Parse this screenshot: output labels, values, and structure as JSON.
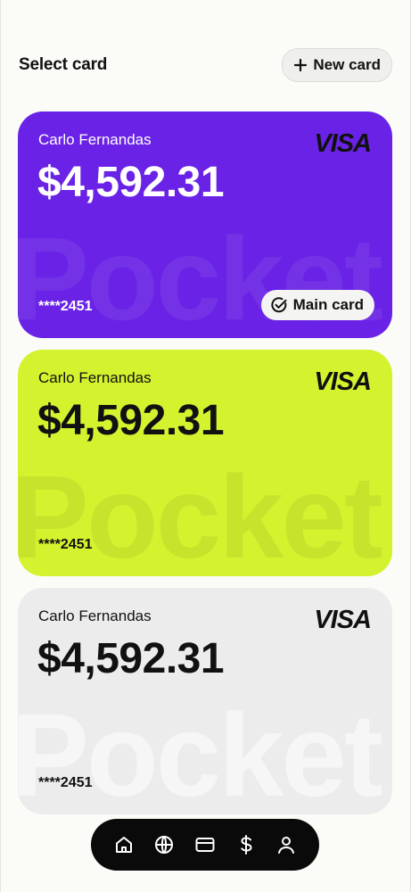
{
  "header": {
    "title": "Select card",
    "new_card_label": "New card"
  },
  "cards": [
    {
      "holder": "Carlo Fernandas",
      "balance": "$4,592.31",
      "brand": "VISA",
      "number": "****2451",
      "watermark": "Pocket",
      "color": "#6a23e6",
      "badge": "Main card"
    },
    {
      "holder": "Carlo Fernandas",
      "balance": "$4,592.31",
      "brand": "VISA",
      "number": "****2451",
      "watermark": "Pocket",
      "color": "#d5f22f"
    },
    {
      "holder": "Carlo Fernandas",
      "balance": "$4,592.31",
      "brand": "VISA",
      "number": "****2451",
      "watermark": "Pocket",
      "color": "#ececec"
    }
  ],
  "nav": {
    "items": [
      "home-icon",
      "globe-icon",
      "card-icon",
      "dollar-icon",
      "user-icon"
    ]
  }
}
